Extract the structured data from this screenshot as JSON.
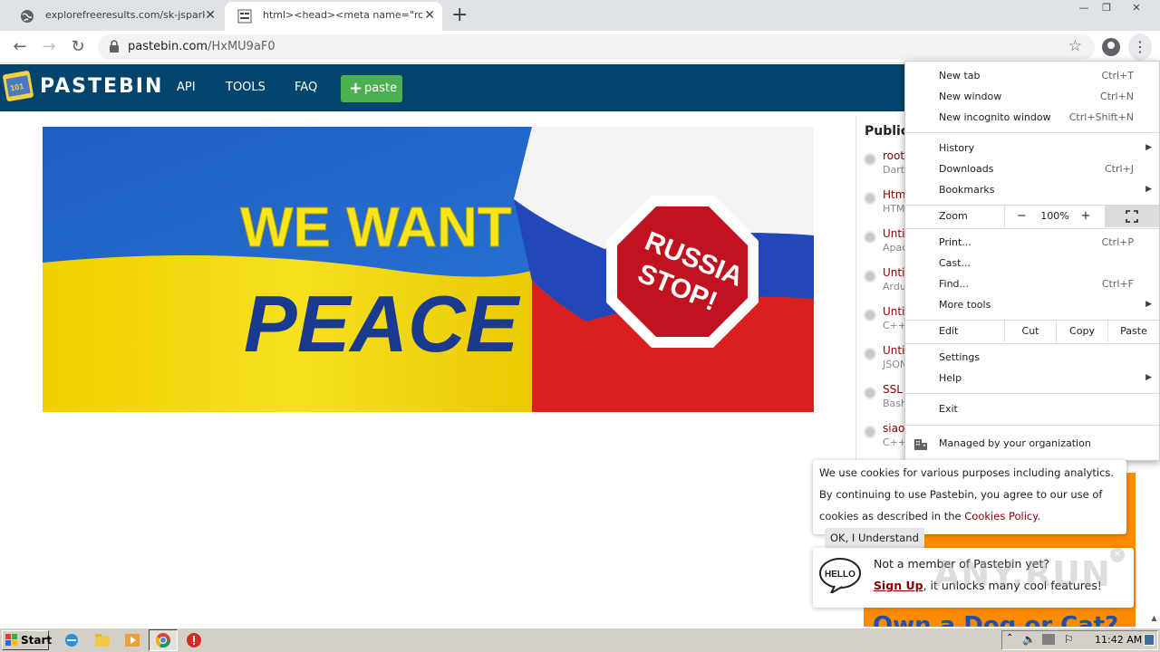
{
  "browser": {
    "tabs": [
      {
        "title": "explorefreeresults.com/sk-jspark.php",
        "close": "✕"
      },
      {
        "title": "html><head><meta name=\"robots\"",
        "close": "✕"
      }
    ],
    "new_tab": "+",
    "window_controls": {
      "minimize": "—",
      "restore": "❐",
      "close": "✕"
    },
    "nav": {
      "back": "←",
      "forward": "→",
      "reload": "↻"
    },
    "url_host": "pastebin.com",
    "url_path": "/HxMU9aF0",
    "star": "☆",
    "menu_button": "⋮"
  },
  "pastebin": {
    "brand": "PASTEBIN",
    "nav": [
      "API",
      "TOOLS",
      "FAQ"
    ],
    "paste_button": "paste",
    "paste_plus": "+"
  },
  "banner": {
    "line1": "WE WANT",
    "line2": "PEACE",
    "sign_line1": "RUSSIA",
    "sign_line2": "STOP!",
    "colors": {
      "blue": "#1f5fc4",
      "yellow": "#f5d80f",
      "red": "#d8201e",
      "text_yellow": "#f8e61a",
      "text_blue": "#1a3a8f"
    }
  },
  "sidebar": {
    "title": "Public Pastes",
    "items": [
      {
        "title": "root_",
        "sub": "Dart"
      },
      {
        "title": "Html",
        "sub": "HTML"
      },
      {
        "title": "Untitled",
        "sub": "Apache"
      },
      {
        "title": "Untitled",
        "sub": "Arduino"
      },
      {
        "title": "Untitled",
        "sub": "C++"
      },
      {
        "title": "Untitled",
        "sub": "JSON"
      },
      {
        "title": "SSL P",
        "sub": "Bash"
      },
      {
        "title": "siaoc",
        "sub": "C++"
      }
    ]
  },
  "chrome_menu": {
    "items_top": [
      {
        "label": "New tab",
        "shortcut": "Ctrl+T"
      },
      {
        "label": "New window",
        "shortcut": "Ctrl+N"
      },
      {
        "label": "New incognito window",
        "shortcut": "Ctrl+Shift+N"
      }
    ],
    "items_mid": [
      {
        "label": "History",
        "shortcut": "",
        "submenu": true
      },
      {
        "label": "Downloads",
        "shortcut": "Ctrl+J",
        "submenu": false
      },
      {
        "label": "Bookmarks",
        "shortcut": "",
        "submenu": true
      }
    ],
    "zoom": {
      "label": "Zoom",
      "minus": "−",
      "value": "100%",
      "plus": "+"
    },
    "items_tools": [
      {
        "label": "Print...",
        "shortcut": "Ctrl+P",
        "submenu": false
      },
      {
        "label": "Cast...",
        "shortcut": "",
        "submenu": false
      },
      {
        "label": "Find...",
        "shortcut": "Ctrl+F",
        "submenu": false
      },
      {
        "label": "More tools",
        "shortcut": "",
        "submenu": true
      }
    ],
    "edit": {
      "label": "Edit",
      "cut": "Cut",
      "copy": "Copy",
      "paste": "Paste"
    },
    "items_settings": [
      {
        "label": "Settings",
        "submenu": false
      },
      {
        "label": "Help",
        "submenu": true
      }
    ],
    "exit": "Exit",
    "managed": "Managed by your organization",
    "arrow": "▶"
  },
  "cookie": {
    "text1": "We use cookies for various purposes including analytics. By continuing to use Pastebin, you agree to our use of cookies as described in the ",
    "link": "Cookies Policy",
    "text2": ".",
    "button": "OK, I Understand"
  },
  "member": {
    "hello": "HELLO",
    "line1": "Not a member of Pastebin yet?",
    "signup": "Sign Up",
    "line2_rest": ", it unlocks many cool features!",
    "close": "✕"
  },
  "ad": {
    "text": "Own a Dog or Cat?"
  },
  "watermark": "ANY.RUN",
  "taskbar": {
    "start": "Start",
    "time": "11:42 AM"
  }
}
